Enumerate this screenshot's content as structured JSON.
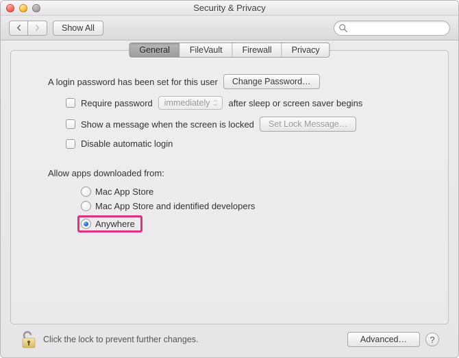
{
  "window": {
    "title": "Security & Privacy"
  },
  "toolbar": {
    "show_all": "Show All",
    "search_placeholder": ""
  },
  "tabs": {
    "general": "General",
    "filevault": "FileVault",
    "firewall": "Firewall",
    "privacy": "Privacy"
  },
  "general": {
    "login_password_set": "A login password has been set for this user",
    "change_password": "Change Password…",
    "require_password_label": "Require password",
    "require_password_delay": "immediately",
    "require_password_suffix": "after sleep or screen saver begins",
    "show_message_label": "Show a message when the screen is locked",
    "set_lock_message": "Set Lock Message…",
    "disable_auto_login": "Disable automatic login",
    "allow_apps_label": "Allow apps downloaded from:",
    "options": {
      "mas": "Mac App Store",
      "mas_dev": "Mac App Store and identified developers",
      "anywhere": "Anywhere"
    }
  },
  "footer": {
    "lock_text": "Click the lock to prevent further changes.",
    "advanced": "Advanced…",
    "help": "?"
  }
}
